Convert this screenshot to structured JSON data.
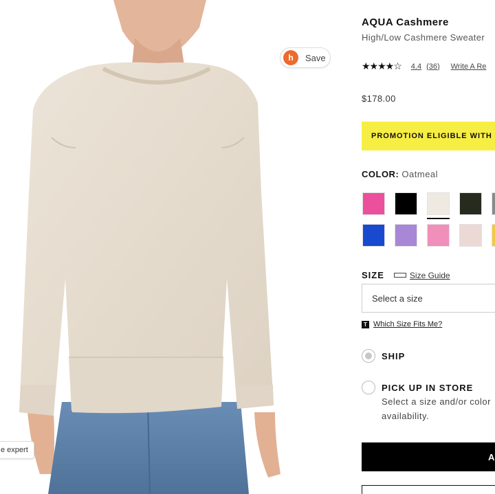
{
  "product_image": {
    "save_label": "Save",
    "expert_tab_label": "e expert"
  },
  "product": {
    "brand": "AQUA Cashmere",
    "name": "High/Low Cashmere Sweater",
    "stars_display": "★★★★☆",
    "rating": "4.4",
    "review_count": "(36)",
    "write_review_label": "Write A Re",
    "price": "$178.00"
  },
  "promo": {
    "text": "PROMOTION ELIGIBLE WITH"
  },
  "color": {
    "label": "COLOR:",
    "selected_value": "Oatmeal",
    "swatches_row1": [
      "#ec4f9b",
      "#000000",
      "#eeeae2",
      "#262b1d",
      "#8a8a8a"
    ],
    "swatches_row2": [
      "#1849cf",
      "#a887d6",
      "#f08fb9",
      "#ecd9d6",
      "#f5c843"
    ]
  },
  "size": {
    "label": "SIZE",
    "guide_label": "Size Guide",
    "select_placeholder": "Select a size",
    "fits_badge": "T",
    "fits_link": "Which Size Fits Me?"
  },
  "fulfillment": {
    "ship_label": "SHIP",
    "pickup_label": "PICK UP IN STORE",
    "pickup_sub_line1": "Select a size and/or color",
    "pickup_sub_line2": "availability."
  },
  "actions": {
    "add_button_label": "A"
  },
  "colors": {
    "promo_yellow": "#f7ee43",
    "save_badge_orange": "#ec6b2d",
    "sweater_oatmeal": "#e8ded0",
    "jeans_blue": "#5a7fa8"
  }
}
